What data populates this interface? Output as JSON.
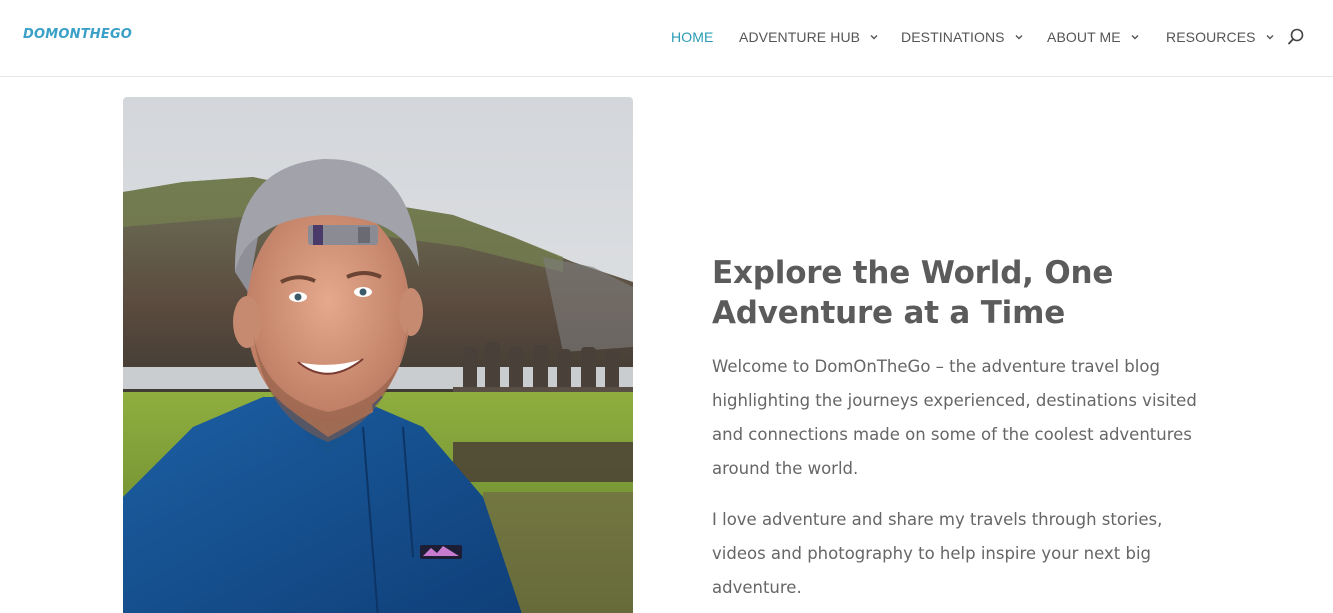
{
  "site": {
    "logo_text": "DOMONTHEGO"
  },
  "nav": {
    "items": [
      {
        "label": "HOME",
        "active": true,
        "has_dropdown": false
      },
      {
        "label": "ADVENTURE HUB",
        "active": false,
        "has_dropdown": true
      },
      {
        "label": "DESTINATIONS",
        "active": false,
        "has_dropdown": true
      },
      {
        "label": "ABOUT ME",
        "active": false,
        "has_dropdown": true
      },
      {
        "label": "RESOURCES",
        "active": false,
        "has_dropdown": true
      }
    ],
    "search_icon": "search-icon",
    "dropdown_icon": "chevron-down-icon"
  },
  "hero": {
    "headline": "Explore the World, One Adventure at a Time",
    "paragraphs": [
      "Welcome to DomOnTheGo – the adventure travel blog highlighting the journeys experienced, destinations visited and connections made on some of the coolest adventures around the world.",
      "I love adventure and share my travels through stories, videos and photography to help inspire your next big adventure."
    ],
    "photo_badge": "patagonia"
  },
  "colors": {
    "accent": "#2b9bb5",
    "logo": "#3aa0c8",
    "nav_text": "#555555",
    "heading": "#5b5b5b",
    "body_text": "#666666"
  }
}
